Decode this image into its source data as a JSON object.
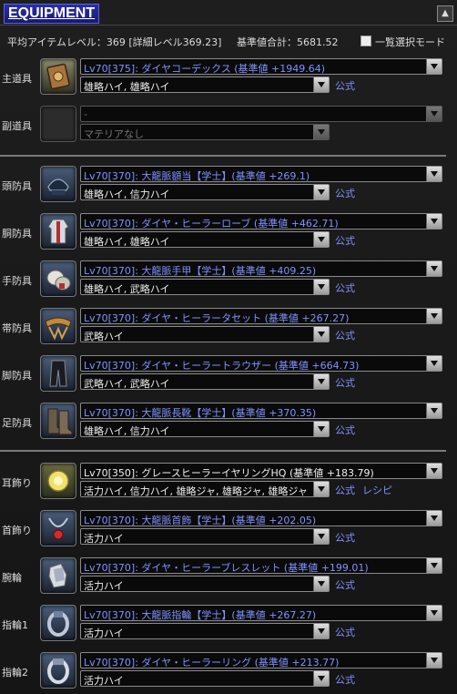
{
  "header": {
    "title": "EQUIPMENT",
    "collapse_icon": "triangle-up-icon"
  },
  "stats": {
    "avg_item_level": "平均アイテムレベル：369 [詳細レベル369.23]",
    "total_base": "基準値合計：5681.52",
    "select_mode_label": "一覧選択モード"
  },
  "slots": [
    {
      "slot": "主道具",
      "item": "Lv70[375]: ダイヤコーデックス (基準値 +1949.64)",
      "melds": "雄略ハイ, 雄略ハイ",
      "link": "公式",
      "icon": "codex-icon"
    },
    {
      "slot": "副道具",
      "item": "-",
      "melds": "マテリアなし",
      "icon": "empty-slot-icon"
    },
    {
      "slot": "頭防具",
      "item": "Lv70[370]: 大龍脈額当【学士】(基準値 +269.1)",
      "melds": "雄略ハイ, 信力ハイ",
      "link": "公式",
      "icon": "headgear-icon"
    },
    {
      "slot": "胴防具",
      "item": "Lv70[370]: ダイヤ・ヒーラーローブ (基準値 +462.71)",
      "melds": "雄略ハイ, 雄略ハイ",
      "link": "公式",
      "icon": "robe-icon"
    },
    {
      "slot": "手防具",
      "item": "Lv70[370]: 大龍脈手甲【学士】(基準値 +409.25)",
      "melds": "雄略ハイ, 武略ハイ",
      "link": "公式",
      "icon": "gloves-icon"
    },
    {
      "slot": "帯防具",
      "item": "Lv70[370]: ダイヤ・ヒーラータセット (基準値 +267.27)",
      "melds": "武略ハイ",
      "link": "公式",
      "icon": "belt-icon"
    },
    {
      "slot": "脚防具",
      "item": "Lv70[370]: ダイヤ・ヒーラートラウザー (基準値 +664.73)",
      "melds": "武略ハイ, 武略ハイ",
      "link": "公式",
      "icon": "trousers-icon"
    },
    {
      "slot": "足防具",
      "item": "Lv70[370]: 大龍脈長靴【学士】(基準値 +370.35)",
      "melds": "雄略ハイ, 信力ハイ",
      "link": "公式",
      "icon": "boots-icon"
    },
    {
      "slot": "耳飾り",
      "item": "Lv70[350]: グレースヒーラーイヤリングHQ (基準値 +183.79)",
      "melds": "活力ハイ, 信力ハイ, 雄略ジャ, 雄略ジャ, 雄略ジャ",
      "link": "公式",
      "link2": "レシピ",
      "icon": "earring-icon"
    },
    {
      "slot": "首飾り",
      "item": "Lv70[370]: 大龍脈首飾【学士】(基準値 +202.05)",
      "melds": "活力ハイ",
      "link": "公式",
      "icon": "necklace-icon"
    },
    {
      "slot": "腕輪",
      "item": "Lv70[370]: ダイヤ・ヒーラーブレスレット (基準値 +199.01)",
      "melds": "活力ハイ",
      "link": "公式",
      "icon": "bracelet-icon"
    },
    {
      "slot": "指輪1",
      "item": "Lv70[370]: 大龍脈指輪【学士】(基準値 +267.27)",
      "melds": "活力ハイ",
      "link": "公式",
      "icon": "ring-icon"
    },
    {
      "slot": "指輪2",
      "item": "Lv70[370]: ダイヤ・ヒーラーリング (基準値 +213.77)",
      "melds": "活力ハイ",
      "link": "公式",
      "icon": "ring-icon"
    }
  ]
}
